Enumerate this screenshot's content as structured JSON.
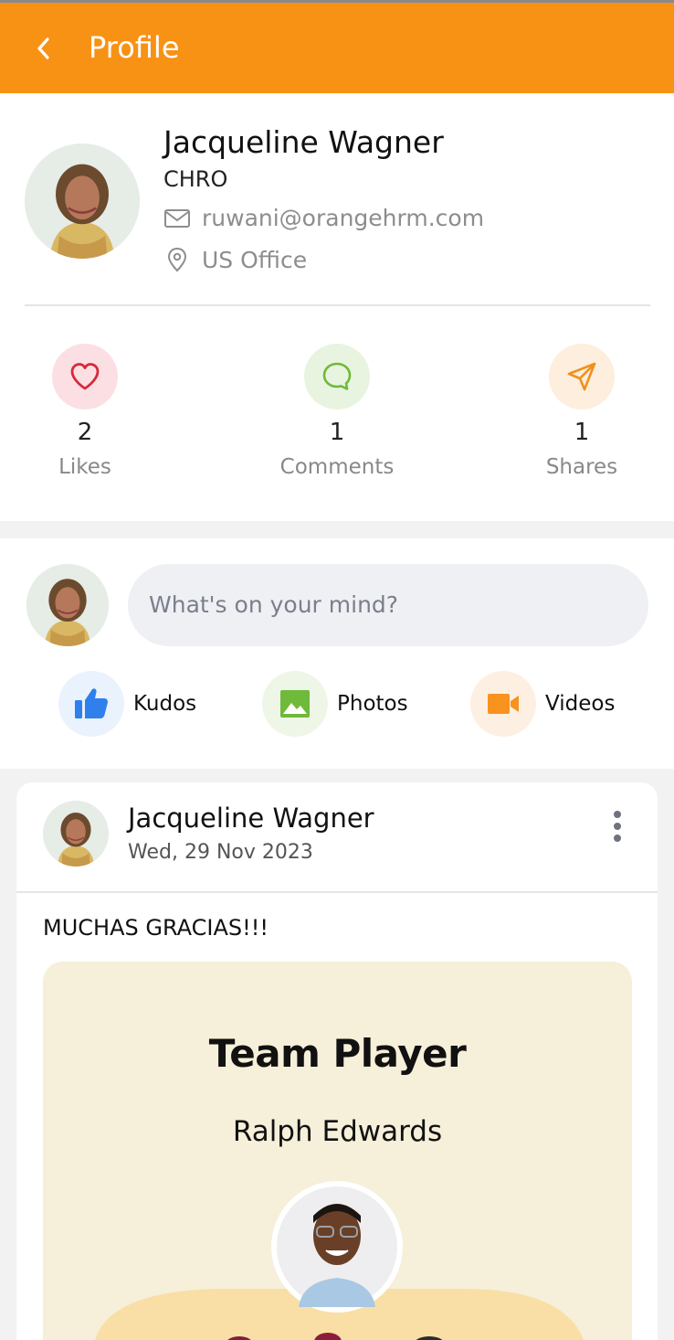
{
  "app_bar": {
    "title": "Profile",
    "back_icon": "chevron-left-icon"
  },
  "profile": {
    "name": "Jacqueline Wagner",
    "role": "CHRO",
    "email": "ruwani@orangehrm.com",
    "location": "US Office"
  },
  "stats": [
    {
      "count": "2",
      "label": "Likes",
      "icon": "heart-icon",
      "color": "#d6293b",
      "bg": "#fbdfe2"
    },
    {
      "count": "1",
      "label": "Comments",
      "icon": "comment-icon",
      "color": "#6fba3a",
      "bg": "#e8f4df"
    },
    {
      "count": "1",
      "label": "Shares",
      "icon": "send-icon",
      "color": "#f0901d",
      "bg": "#fdeedd"
    }
  ],
  "composer": {
    "placeholder": "What's on your mind?",
    "actions": [
      {
        "label": "Kudos",
        "icon": "thumbs-up-icon",
        "color": "#2f80ed"
      },
      {
        "label": "Photos",
        "icon": "image-icon",
        "color": "#6fba3a"
      },
      {
        "label": "Videos",
        "icon": "video-camera-icon",
        "color": "#f7931e"
      }
    ]
  },
  "post": {
    "author": "Jacqueline Wagner",
    "date": "Wed, 29 Nov 2023",
    "text": "MUCHAS GRACIAS!!!",
    "kudos": {
      "title": "Team Player",
      "recipient": "Ralph Edwards"
    }
  },
  "colors": {
    "brand_orange": "#f89214"
  }
}
